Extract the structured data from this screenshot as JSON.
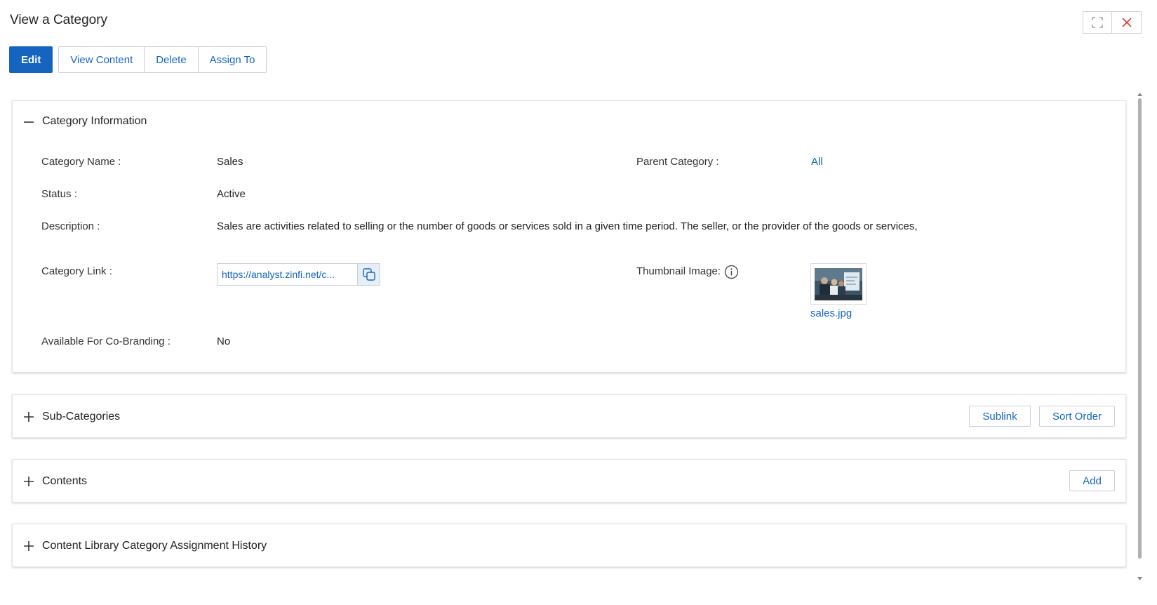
{
  "header": {
    "title": "View a Category",
    "expand_icon": "expand-icon",
    "close_icon": "close-icon",
    "close_color": "#e53935"
  },
  "toolbar": {
    "edit_label": "Edit",
    "view_content_label": "View Content",
    "delete_label": "Delete",
    "assign_to_label": "Assign To"
  },
  "category_info": {
    "title": "Category Information",
    "toggle": "minus",
    "category_name_label": "Category Name :",
    "category_name_value": "Sales",
    "parent_category_label": "Parent Category :",
    "parent_category_value": "All",
    "status_label": "Status :",
    "status_value": "Active",
    "description_label": "Description :",
    "description_value": "Sales are activities related to selling or the number of goods or services sold in a given time period. The seller, or the provider of the goods or services,",
    "category_link_label": "Category Link :",
    "category_link_value": "https://analyst.zinfi.net/c...",
    "thumbnail_label": "Thumbnail Image:",
    "thumbnail_filename": "sales.jpg",
    "co_branding_label": "Available For Co-Branding :",
    "co_branding_value": "No"
  },
  "sub_categories": {
    "title": "Sub-Categories",
    "sublink_label": "Sublink",
    "sort_order_label": "Sort Order"
  },
  "contents": {
    "title": "Contents",
    "add_label": "Add"
  },
  "assignment_history": {
    "title": "Content Library Category Assignment History"
  },
  "colors": {
    "accent": "#1565c0",
    "border": "#c9d0d8"
  }
}
